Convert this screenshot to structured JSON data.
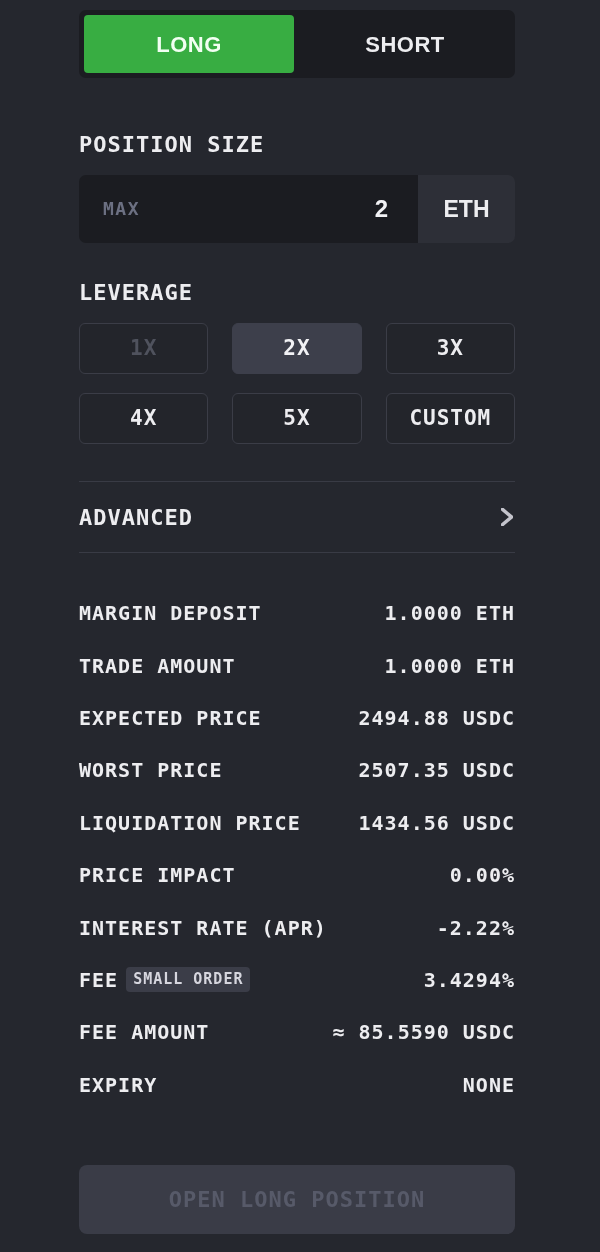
{
  "side_toggle": [
    {
      "label": "LONG",
      "selected": true
    },
    {
      "label": "SHORT",
      "selected": false
    }
  ],
  "position_size": {
    "label": "POSITION SIZE",
    "max_button": "MAX",
    "value": "2",
    "unit": "ETH"
  },
  "leverage": {
    "label": "LEVERAGE",
    "options": [
      {
        "label": "1X",
        "selected": false,
        "disabled": true
      },
      {
        "label": "2X",
        "selected": true,
        "disabled": false
      },
      {
        "label": "3X",
        "selected": false,
        "disabled": false
      },
      {
        "label": "4X",
        "selected": false,
        "disabled": false
      },
      {
        "label": "5X",
        "selected": false,
        "disabled": false
      },
      {
        "label": "CUSTOM",
        "selected": false,
        "disabled": false
      }
    ]
  },
  "advanced": {
    "label": "ADVANCED",
    "expanded": false
  },
  "details": [
    {
      "label": "MARGIN DEPOSIT",
      "value": "1.0000 ETH"
    },
    {
      "label": "TRADE AMOUNT",
      "value": "1.0000 ETH"
    },
    {
      "label": "EXPECTED PRICE",
      "value": "2494.88 USDC"
    },
    {
      "label": "WORST PRICE",
      "value": "2507.35 USDC"
    },
    {
      "label": "LIQUIDATION PRICE",
      "value": "1434.56 USDC"
    },
    {
      "label": "PRICE IMPACT",
      "value": "0.00%"
    },
    {
      "label": "INTEREST RATE (APR)",
      "value": "-2.22%"
    },
    {
      "label": "FEE",
      "badge": "SMALL ORDER",
      "value": "3.4294%"
    },
    {
      "label": "FEE AMOUNT",
      "value": "≈ 85.5590 USDC"
    },
    {
      "label": "EXPIRY",
      "value": "NONE"
    }
  ],
  "submit_button": {
    "label": "OPEN LONG POSITION",
    "disabled": true
  }
}
